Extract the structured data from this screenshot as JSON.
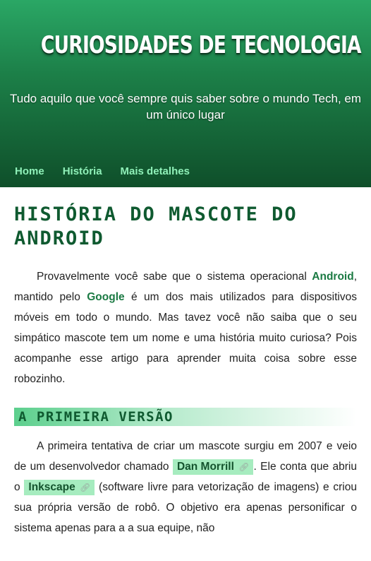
{
  "header": {
    "title": "CURIOSIDADES DE TECNOLOGIA",
    "subtitle": "Tudo aquilo que você sempre quis saber sobre o mundo Tech, em um único lugar"
  },
  "nav": {
    "items": [
      {
        "label": "Home"
      },
      {
        "label": "História"
      },
      {
        "label": "Mais detalhes"
      }
    ]
  },
  "article": {
    "title": "HISTÓRIA DO MASCOTE DO ANDROID",
    "intro": {
      "t1": "Provavelmente você sabe que o sistema operacional ",
      "android": "Android",
      "t2": ", mantido pelo ",
      "google": "Google",
      "t3": " é um dos mais utilizados para dispositivos móveis em todo o mundo. Mas tavez você não saiba que o seu simpático mascote tem um nome e uma história muito curiosa? Pois acompanhe esse artigo para aprender muita coisa sobre esse robozinho."
    },
    "section1": {
      "heading": "A PRIMEIRA VERSÃO",
      "t1": "A primeira tentativa de criar um mascote surgiu em 2007 e veio de um desenvolvedor chamado ",
      "link1": "Dan Morrill",
      "t2": ". Ele conta que abriu o ",
      "link2": "Inkscape",
      "t3": " (software livre para vetorização de imagens) e criou sua própria versão de robô. O objetivo era apenas personificar o sistema apenas para a a sua equipe, não"
    }
  },
  "icons": {
    "external_link": "link-icon"
  },
  "colors": {
    "header_top": "#2aa765",
    "header_bottom": "#0f4f2a",
    "nav_link": "#8ff0b8",
    "title_green": "#0f5a30",
    "highlight_bg": "#a6ecbf"
  }
}
